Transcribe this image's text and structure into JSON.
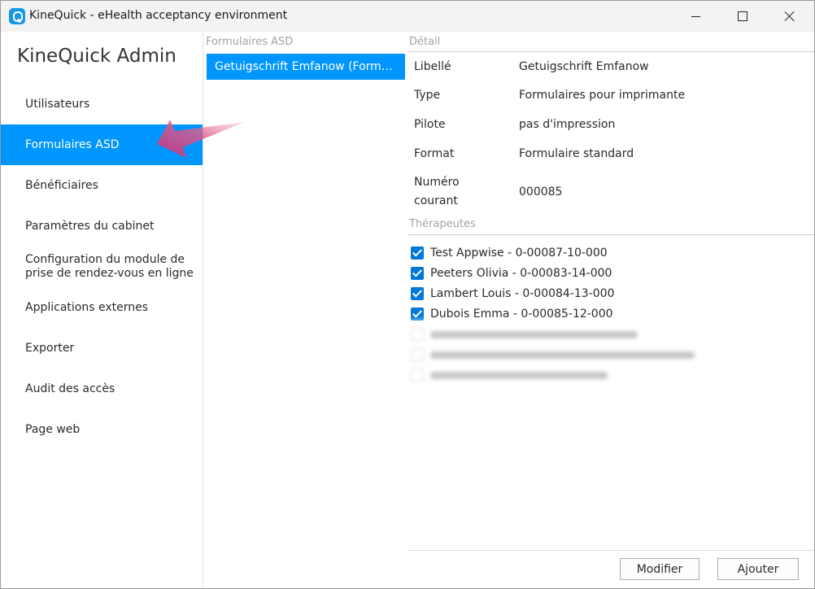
{
  "window": {
    "title": "KineQuick - eHealth acceptancy environment",
    "icon": "kinequick-app-icon"
  },
  "sidebar": {
    "heading": "KineQuick Admin",
    "items": [
      {
        "label": "Utilisateurs"
      },
      {
        "label": "Formulaires ASD",
        "active": true
      },
      {
        "label": "Bénéficiaires"
      },
      {
        "label": "Paramètres du cabinet"
      },
      {
        "label": "Configuration du module de prise de rendez-vous en ligne"
      },
      {
        "label": "Applications externes"
      },
      {
        "label": "Exporter"
      },
      {
        "label": "Audit des accès"
      },
      {
        "label": "Page web"
      }
    ]
  },
  "list": {
    "header": "Formulaires ASD",
    "items": [
      {
        "label": "Getuigschrift Emfanow (Form…",
        "selected": true
      }
    ]
  },
  "detail": {
    "header": "Détail",
    "fields": [
      {
        "label": "Libellé",
        "value": "Getuigschrift Emfanow"
      },
      {
        "label": "Type",
        "value": "Formulaires pour imprimante"
      },
      {
        "label": "Pilote",
        "value": "pas d'impression"
      },
      {
        "label": "Format",
        "value": "Formulaire standard"
      },
      {
        "label": "Numéro courant",
        "value": "000085"
      }
    ],
    "therapists_header": "Thérapeutes",
    "therapists": [
      {
        "label": "Test Appwise - 0-00087-10-000",
        "checked": true
      },
      {
        "label": "Peeters Olivia - 0-00083-14-000",
        "checked": true
      },
      {
        "label": "Lambert Louis - 0-00084-13-000",
        "checked": true
      },
      {
        "label": "Dubois Emma - 0-00085-12-000",
        "checked": true
      }
    ],
    "buttons": {
      "modify": "Modifier",
      "add": "Ajouter"
    }
  },
  "colors": {
    "accent": "#0096ff",
    "checkbox": "#0078d7",
    "pointer_arrow": "#d6457f"
  }
}
